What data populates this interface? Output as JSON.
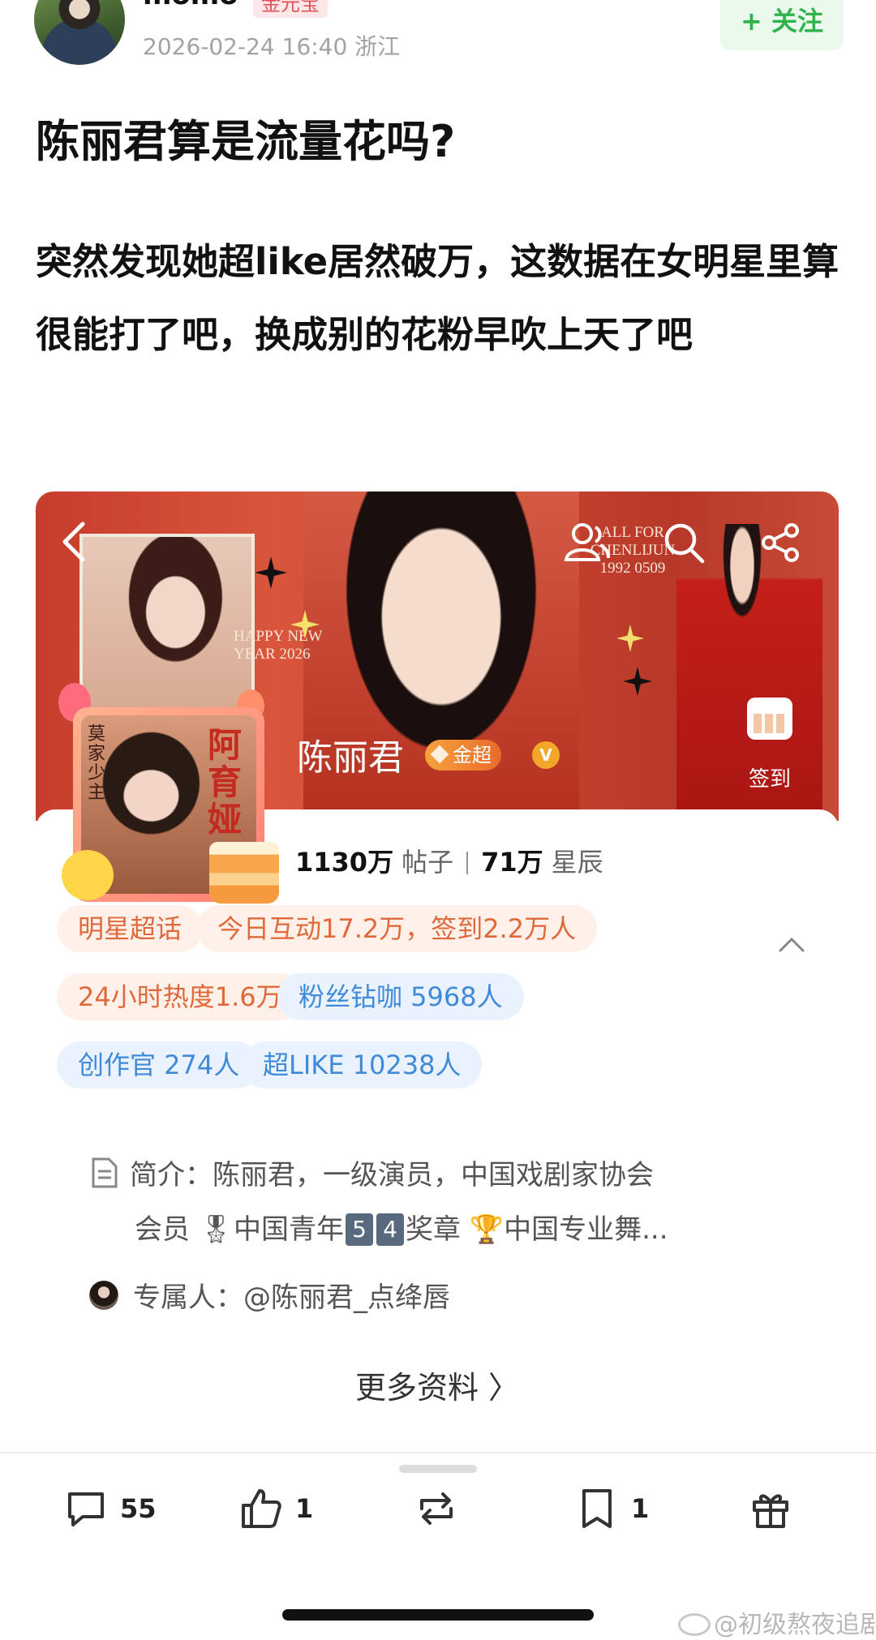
{
  "post": {
    "username": "momo",
    "user_badge": "金元宝",
    "meta": "2026-02-24 16:40  浙江",
    "follow_label": "+ 关注",
    "title": "陈丽君算是流量花吗?",
    "body": "突然发现她超like居然破万，这数据在女明星里算很能打了吧，换成别的花粉早吹上天了吧"
  },
  "card": {
    "banner": {
      "poster_text_1": "ALL FOR CHENLIJUN 1992 0509",
      "poster_text_2": "HAPPY NEW YEAR 2026",
      "name": "陈丽君",
      "level_badge": "金超",
      "vip_badge": "V",
      "checkin_label": "签到"
    },
    "avatar_frame": {
      "title_vertical": "阿育娅",
      "subtitle_vertical": "莫家少主"
    },
    "stats": {
      "posts_value": "1130万",
      "posts_label": "帖子",
      "stars_value": "71万",
      "stars_label": "星辰"
    },
    "chips": [
      {
        "label": "明星超话",
        "tone": "orange"
      },
      {
        "label": "今日互动17.2万，签到2.2万人",
        "tone": "orange"
      },
      {
        "label": "24小时热度1.6万",
        "tone": "orange"
      },
      {
        "label": "粉丝钻咖 5968人",
        "tone": "blue"
      },
      {
        "label": "创作官 274人",
        "tone": "blue"
      },
      {
        "label": "超LIKE 10238人",
        "tone": "blue"
      }
    ],
    "intro": {
      "line1": "简介：陈丽君，一级演员，中国戏剧家协会",
      "line2_pre": "会员 🎖中国青年",
      "key_5": "5",
      "key_4": "4",
      "line2_post": "奖章 🏆中国专业舞..."
    },
    "exclusive": "专属人：@陈丽君_点绛唇",
    "more_info": "更多资料 〉"
  },
  "actions": {
    "comment_count": "55",
    "like_count": "1",
    "repost_count": "",
    "favorite_count": "1"
  },
  "watermark": "@初级熬夜追剧",
  "colors": {
    "accent_green": "#2fb34a",
    "chip_orange": "#e0693a",
    "chip_blue": "#3f8ad9",
    "banner_red": "#c63d2c"
  },
  "icons": [
    "back-icon",
    "group-icon",
    "search-icon",
    "share-icon",
    "calendar-icon",
    "chevron-up-icon",
    "document-icon",
    "comment-icon",
    "like-icon",
    "repost-icon",
    "favorite-icon",
    "gift-icon",
    "weibo-icon"
  ]
}
